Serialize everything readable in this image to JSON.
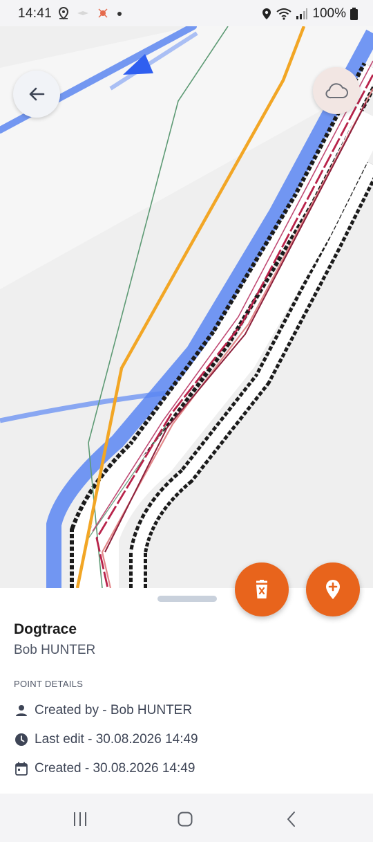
{
  "status_bar": {
    "time": "14:41",
    "battery_text": "100%",
    "icons": [
      "location-icon",
      "wifi-icon",
      "signal-icon",
      "battery-icon"
    ]
  },
  "map": {
    "back_icon": "arrow-left-icon",
    "cloud_icon": "cloud-icon"
  },
  "actions": {
    "delete_icon": "trash-icon",
    "add_point_icon": "map-pin-plus-icon",
    "accent_color": "#e8641c"
  },
  "sheet": {
    "title": "Dogtrace",
    "subtitle": "Bob HUNTER",
    "section_label": "POINT DETAILS",
    "details": [
      {
        "icon": "person-icon",
        "text": "Created by - Bob HUNTER"
      },
      {
        "icon": "clock-icon",
        "text": "Last edit - 30.08.2026 14:49"
      },
      {
        "icon": "calendar-icon",
        "text": "Created - 30.08.2026 14:49"
      }
    ]
  },
  "nav_bar": {
    "icons": [
      "recents-icon",
      "home-icon",
      "back-icon"
    ]
  }
}
